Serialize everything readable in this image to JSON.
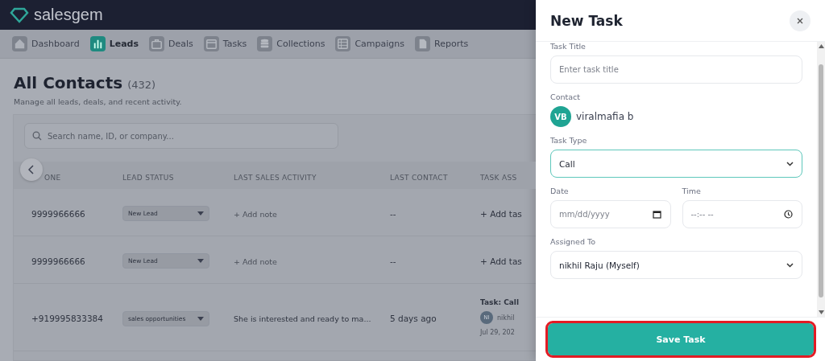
{
  "app": {
    "brand": "salesgem",
    "nav": [
      {
        "label": "Dashboard",
        "selected": false
      },
      {
        "label": "Leads",
        "selected": true
      },
      {
        "label": "Deals",
        "selected": false
      },
      {
        "label": "Tasks",
        "selected": false
      },
      {
        "label": "Collections",
        "selected": false
      },
      {
        "label": "Campaigns",
        "selected": false
      },
      {
        "label": "Reports",
        "selected": false
      }
    ],
    "page": {
      "title": "All Contacts",
      "count": "(432)",
      "subtitle": "Manage all leads, deals, and recent activity."
    },
    "search": {
      "placeholder": "Search name, ID, or company..."
    },
    "table": {
      "columns": [
        "ONE",
        "LEAD STATUS",
        "LAST SALES ACTIVITY",
        "LAST CONTACT",
        "TASK ASS"
      ],
      "rows": [
        {
          "phone": "9999966666",
          "status": "New Lead",
          "activity": {
            "kind": "add",
            "text": "+ Add note"
          },
          "last_contact": "--",
          "task": {
            "kind": "add",
            "label": "+ Add tas"
          }
        },
        {
          "phone": "9999966666",
          "status": "New Lead",
          "activity": {
            "kind": "add",
            "text": "+ Add note"
          },
          "last_contact": "--",
          "task": {
            "kind": "add",
            "label": "+ Add tas"
          }
        },
        {
          "phone": "+919995833384",
          "status": "sales opportunities",
          "activity": {
            "kind": "note",
            "text": "She is interested and ready to ma..."
          },
          "last_contact": "5 days ago",
          "task": {
            "kind": "assigned",
            "title": "Task: Call",
            "initials": "NI",
            "assignee": "nikhil",
            "date": "Jul 29, 202"
          }
        }
      ]
    }
  },
  "drawer": {
    "title": "New Task",
    "fields": [
      {
        "kind": "text",
        "label": "Task Title",
        "placeholder": "Enter task title"
      },
      {
        "kind": "contact",
        "label": "Contact",
        "initials": "VB",
        "name": "viralmafia b"
      },
      {
        "kind": "select",
        "label": "Task Type",
        "value": "Call",
        "focused": true
      },
      {
        "kind": "pair",
        "items": [
          {
            "kind": "date",
            "label": "Date",
            "placeholder": "mm/dd/yyyy"
          },
          {
            "kind": "time",
            "label": "Time",
            "placeholder": "--:-- --"
          }
        ]
      },
      {
        "kind": "select",
        "label": "Assigned To",
        "value": "nikhil Raju (Myself)",
        "focused": false
      }
    ],
    "save": {
      "label": "Save Task",
      "highlighted": true
    }
  }
}
